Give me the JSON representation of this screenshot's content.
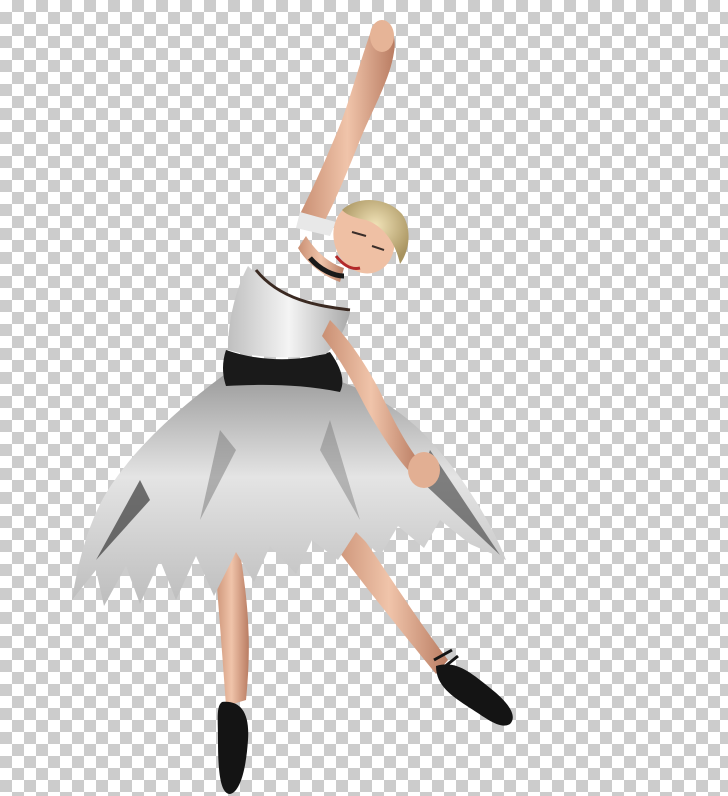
{
  "image": {
    "background": "transparency-checkerboard",
    "subject": "ballerina",
    "colors": {
      "checker_light": "#ffffff",
      "checker_dark": "#cccccc",
      "dress_bodice": "#e8e8e8",
      "skirt_light": "#dcdcdc",
      "skirt_dark": "#3a3a3a",
      "sash": "#1a1a1a",
      "skin": "#e7b79a",
      "hair": "#d9c79a",
      "shoes": "#141414"
    }
  }
}
